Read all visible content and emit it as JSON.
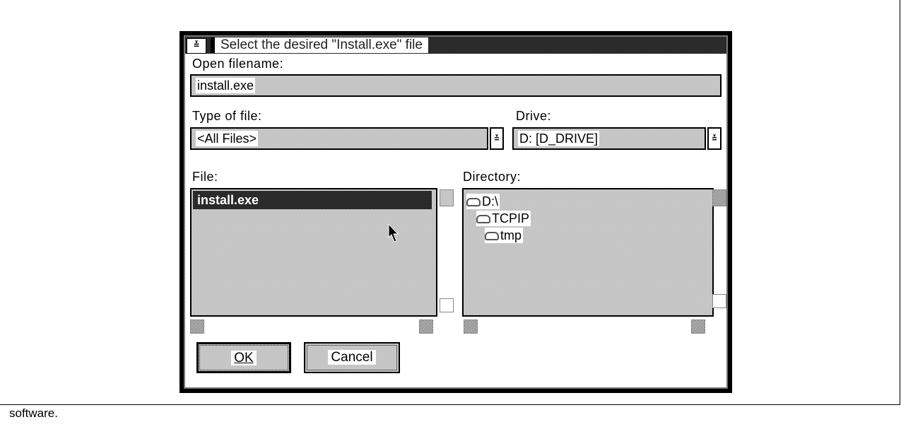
{
  "dialog": {
    "title": "Select the desired \"Install.exe\" file",
    "system_menu_glyph": "≚",
    "open_filename_label": "Open filename:",
    "open_filename_value": "install.exe",
    "type_of_file_label": "Type of file:",
    "type_of_file_value": "<All Files>",
    "drive_label": "Drive:",
    "drive_value": "D:  [D_DRIVE]",
    "spin_glyph": "≚",
    "file_label": "File:",
    "files": [
      "install.exe"
    ],
    "directory_label": "Directory:",
    "directories": [
      "D:\\",
      "TCPIP",
      "tmp"
    ],
    "ok_label": "OK",
    "cancel_label": "Cancel"
  },
  "caption": "software.",
  "icons": {
    "folder_open": "folder-open-icon",
    "folder_closed": "folder-icon",
    "cursor": "mouse-pointer-icon"
  }
}
